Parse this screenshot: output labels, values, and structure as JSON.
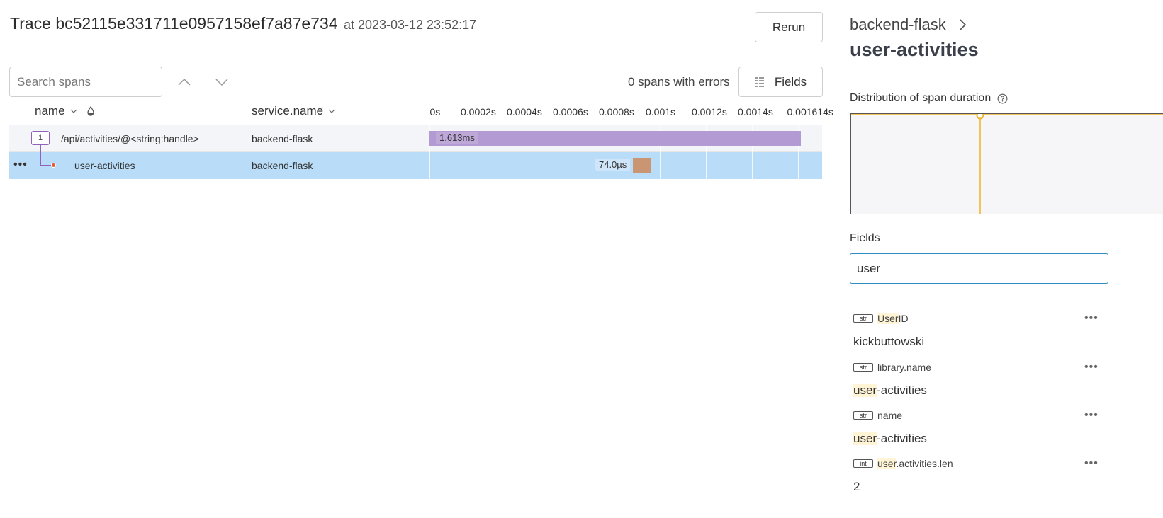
{
  "header": {
    "trace_label": "Trace bc52115e331711e0957158ef7a87e734",
    "timestamp": "at 2023-03-12 23:52:17",
    "rerun_label": "Rerun"
  },
  "toolbar": {
    "search_placeholder": "Search spans",
    "errors_text": "0 spans with errors",
    "fields_label": "Fields"
  },
  "table": {
    "columns": {
      "name": "name",
      "service": "service.name"
    },
    "ticks": [
      "0s",
      "0.0002s",
      "0.0004s",
      "0.0006s",
      "0.0008s",
      "0.001s",
      "0.0012s",
      "0.0014s",
      "0.001614s"
    ],
    "total_duration_s": 0.001614,
    "rows": [
      {
        "child_count": "1",
        "name": "/api/activities/@<string:handle>",
        "service": "backend-flask",
        "duration_label": "1.613ms",
        "start_s": 0,
        "duration_s": 0.001613,
        "color": "#b39ad3"
      },
      {
        "name": "user-activities",
        "service": "backend-flask",
        "duration_label": "74.0µs",
        "start_s": 0.000884,
        "duration_s": 7.4e-05,
        "color": "#c99572"
      }
    ]
  },
  "panel": {
    "service": "backend-flask",
    "span_name": "user-activities",
    "distribution_title": "Distribution of span duration",
    "fields_title": "Fields",
    "filter_value": "user",
    "fields": [
      {
        "type": "str",
        "name_hl": "User",
        "name_rest": "ID",
        "value_hl": "",
        "value_rest": "kickbuttowski"
      },
      {
        "type": "str",
        "name_hl": "",
        "name_rest": "library.name",
        "value_hl": "user",
        "value_rest": "-activities"
      },
      {
        "type": "str",
        "name_hl": "",
        "name_rest": "name",
        "value_hl": "user",
        "value_rest": "-activities"
      },
      {
        "type": "int",
        "name_hl": "user",
        "name_rest": ".activities.len",
        "value_hl": "",
        "value_rest": "2"
      }
    ]
  },
  "colors": {
    "accent_purple": "#8e63b9",
    "selected_row": "#b9ddf8",
    "highlight": "#fff5d6",
    "marker": "#f0b429",
    "filter_border": "#2f8cc2"
  }
}
